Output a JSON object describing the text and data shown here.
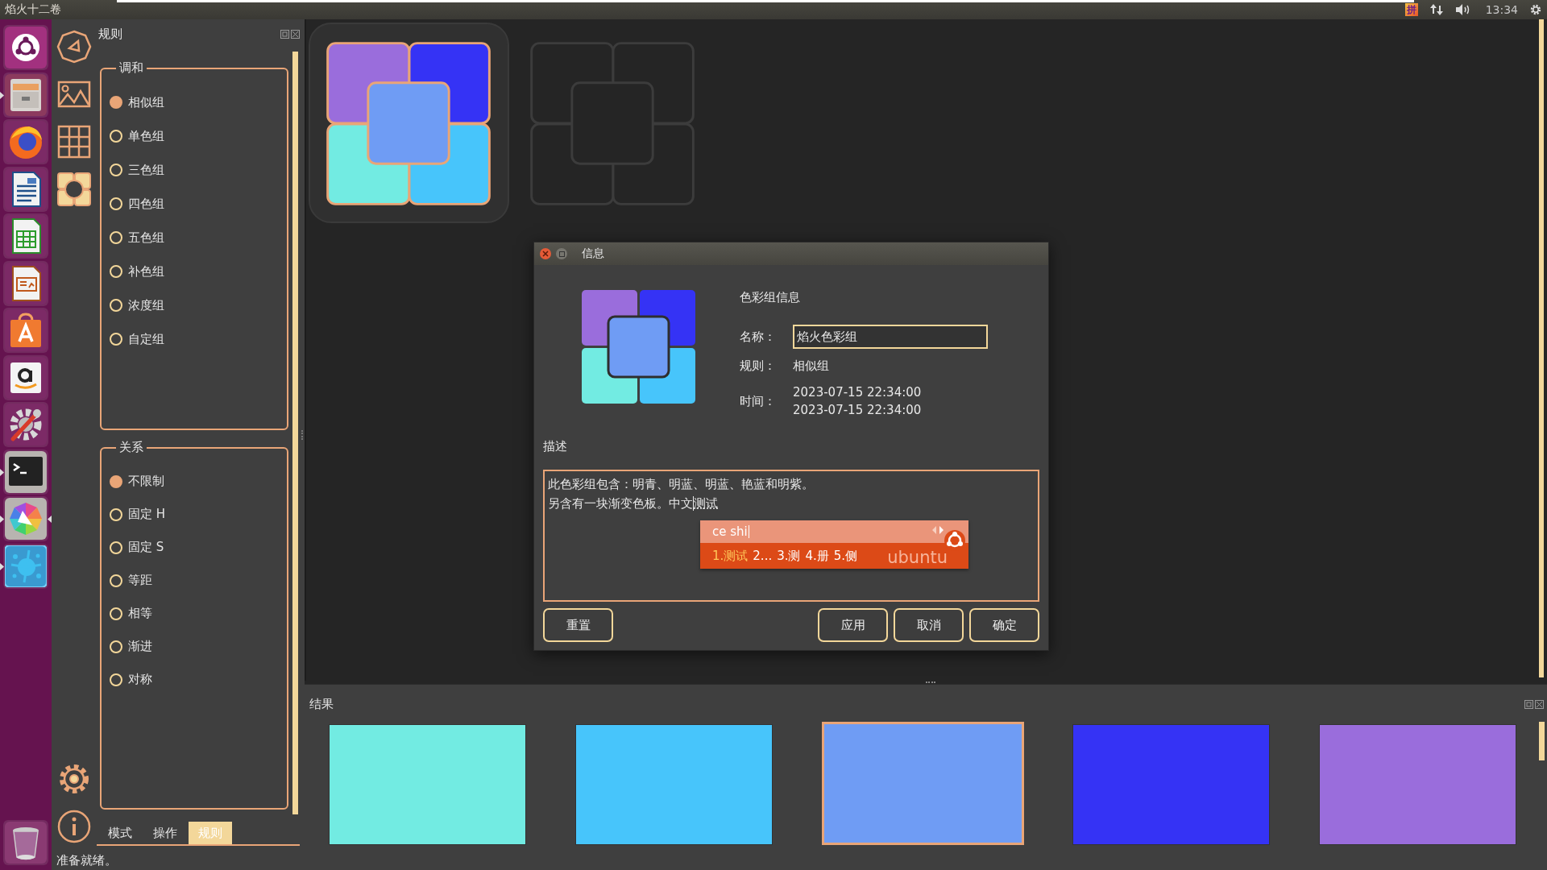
{
  "top_bar": {
    "title": "焰火十二卷",
    "input_method": "拼",
    "clock": "13:34"
  },
  "launcher": {
    "items": [
      {
        "kind": "dash",
        "running": false,
        "focused": false
      },
      {
        "kind": "files",
        "running": true,
        "focused": false
      },
      {
        "kind": "browser",
        "running": false,
        "focused": false
      },
      {
        "kind": "writer",
        "running": false,
        "focused": false
      },
      {
        "kind": "calc",
        "running": false,
        "focused": false
      },
      {
        "kind": "impress",
        "running": false,
        "focused": false
      },
      {
        "kind": "store",
        "running": false,
        "focused": false
      },
      {
        "kind": "amazon",
        "running": false,
        "focused": false
      },
      {
        "kind": "settings",
        "running": false,
        "focused": false
      },
      {
        "kind": "terminal",
        "running": true,
        "focused": false
      },
      {
        "kind": "colorwheel",
        "running": true,
        "focused": true
      },
      {
        "kind": "splash",
        "running": true,
        "focused": false
      }
    ]
  },
  "tools": [
    {
      "kind": "triangle",
      "selected": false
    },
    {
      "kind": "image",
      "selected": false
    },
    {
      "kind": "grid",
      "selected": false
    },
    {
      "kind": "rings",
      "selected": true
    }
  ],
  "rules_panel": {
    "title": "规则",
    "groups": [
      {
        "title": "调和",
        "options": [
          {
            "label": "相似组",
            "selected": true
          },
          {
            "label": "单色组",
            "selected": false
          },
          {
            "label": "三色组",
            "selected": false
          },
          {
            "label": "四色组",
            "selected": false
          },
          {
            "label": "五色组",
            "selected": false
          },
          {
            "label": "补色组",
            "selected": false
          },
          {
            "label": "浓度组",
            "selected": false
          },
          {
            "label": "自定组",
            "selected": false
          }
        ]
      },
      {
        "title": "关系",
        "options": [
          {
            "label": "不限制",
            "selected": true
          },
          {
            "label": "固定 H",
            "selected": false
          },
          {
            "label": "固定 S",
            "selected": false
          },
          {
            "label": "等距",
            "selected": false
          },
          {
            "label": "相等",
            "selected": false
          },
          {
            "label": "渐进",
            "selected": false
          },
          {
            "label": "对称",
            "selected": false
          }
        ]
      }
    ],
    "tabs": [
      {
        "label": "模式",
        "selected": false
      },
      {
        "label": "操作",
        "selected": false
      },
      {
        "label": "规则",
        "selected": true
      }
    ]
  },
  "palettes": [
    {
      "kind": "filled",
      "selected": true,
      "cells": [
        {
          "color": "#9a6ddc"
        },
        {
          "color": "#3533f5"
        },
        {
          "color": "#72ebe2"
        },
        {
          "color": "#47c5fb"
        },
        {
          "color": "#6f9cf4"
        }
      ]
    },
    {
      "kind": "empty",
      "selected": false
    }
  ],
  "dialog": {
    "title": "信息",
    "preview": [
      {
        "color": "#9a6ddc"
      },
      {
        "color": "#3533f5"
      },
      {
        "color": "#72ebe2"
      },
      {
        "color": "#47c5fb"
      },
      {
        "color": "#6f9cf4"
      }
    ],
    "heading": "色彩组信息",
    "name_label": "名称：",
    "name_value": "焰火色彩组",
    "rule_label": "规则：",
    "rule_value": "相似组",
    "time_label": "时间：",
    "times": [
      "2023-07-15 22:34:00",
      "2023-07-15 22:34:00"
    ],
    "description_label": "描述",
    "description_lines": [
      "此色彩组包含：明青、明蓝、明蓝、艳蓝和明紫。",
      "另含有一块渐变色板。中文"
    ],
    "preedit": "测试",
    "ime": {
      "input": "ce shi",
      "brand": "ubuntu",
      "candidates": [
        {
          "index": "1.",
          "text": "测试",
          "selected": true
        },
        {
          "index": "2",
          "text": "...",
          "selected": false
        },
        {
          "index": "3.",
          "text": "测",
          "selected": false
        },
        {
          "index": "4.",
          "text": "册",
          "selected": false
        },
        {
          "index": "5.",
          "text": "侧",
          "selected": false
        }
      ]
    },
    "buttons": [
      "重置",
      "应用",
      "取消",
      "确定"
    ]
  },
  "results": {
    "title": "结果",
    "swatches": [
      {
        "color": "#72ebe2",
        "selected": false
      },
      {
        "color": "#47c5fb",
        "selected": false
      },
      {
        "color": "#6f9cf4",
        "selected": true
      },
      {
        "color": "#3533f5",
        "selected": false
      },
      {
        "color": "#9a6ddc",
        "selected": false
      }
    ]
  },
  "status_bar": {
    "text": "准备就绪。"
  }
}
